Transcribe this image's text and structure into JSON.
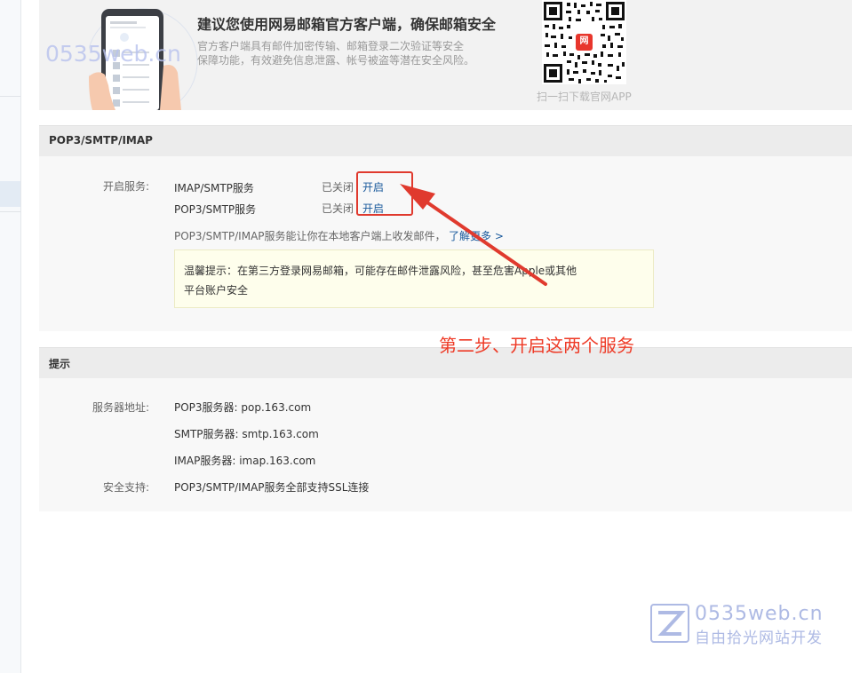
{
  "promo": {
    "title": "建议您使用网易邮箱官方客户端，确保邮箱安全",
    "desc_line1": "官方客户端具有邮件加密传输、邮箱登录二次验证等安全",
    "desc_line2": "保障功能，有效避免信息泄露、帐号被盗等潜在安全风险。",
    "qr_caption": "扫一扫下载官网APP",
    "qr_logo": "网"
  },
  "pop_section": {
    "header": "POP3/SMTP/IMAP",
    "service_label": "开启服务:",
    "services": [
      {
        "name": "IMAP/SMTP服务",
        "status": "已关闭",
        "action": "开启"
      },
      {
        "name": "POP3/SMTP服务",
        "status": "已关闭",
        "action": "开启"
      }
    ],
    "help_text": "POP3/SMTP/IMAP服务能让你在本地客户端上收发邮件，",
    "help_link": "了解更多 >",
    "notice_line1": "温馨提示：在第三方登录网易邮箱，可能存在邮件泄露风险，甚至危害Apple或其他",
    "notice_line2": "平台账户安全"
  },
  "tips_section": {
    "header": "提示",
    "server_label": "服务器地址:",
    "servers": [
      "POP3服务器: pop.163.com",
      "SMTP服务器: smtp.163.com",
      "IMAP服务器: imap.163.com"
    ],
    "security_label": "安全支持:",
    "security_text": "POP3/SMTP/IMAP服务全部支持SSL连接"
  },
  "annotation": {
    "text": "第二步、开启这两个服务",
    "color": "#ee3a26"
  },
  "watermark": {
    "top": "0535web.cn",
    "domain": "0535web.cn",
    "slogan": "自由拾光网站开发"
  }
}
